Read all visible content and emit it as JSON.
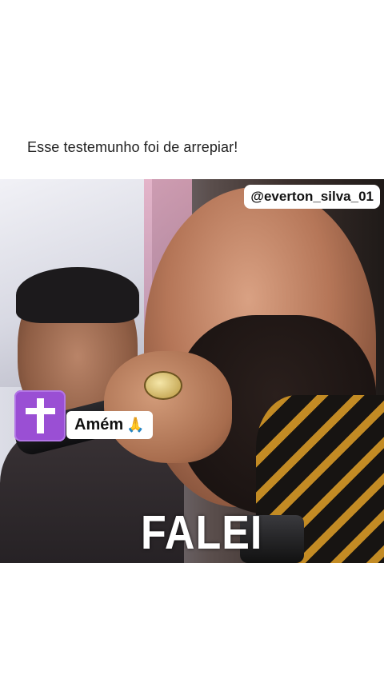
{
  "post": {
    "caption": "Esse testemunho foi de arrepiar!"
  },
  "video": {
    "watermark": "@everton_silva_01",
    "sticker_amen": "Amém",
    "sticker_amen_emoji": "🙏",
    "cross_icon": "latin-cross-icon",
    "overlay_word": "FALEI"
  },
  "colors": {
    "cross_sticker_bg": "#9a4fd4",
    "background": "#ffffff"
  }
}
